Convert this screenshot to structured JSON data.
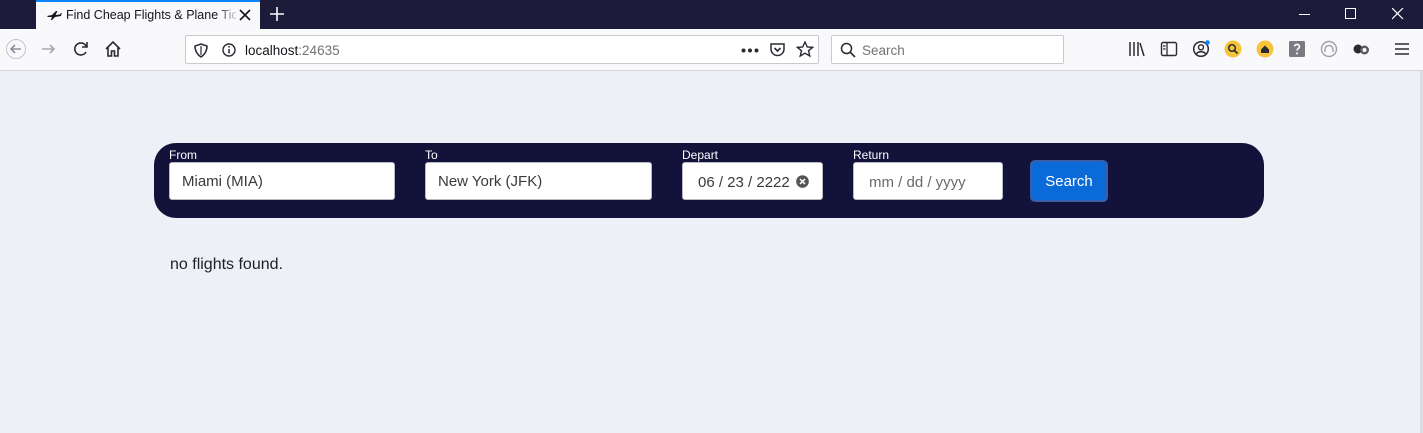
{
  "browser": {
    "tab_title": "Find Cheap Flights & Plane Tickets",
    "url_host": "localhost",
    "url_port": ":24635",
    "search_placeholder": "Search",
    "accent_color": "#0a84ff"
  },
  "form": {
    "from_label": "From",
    "from_value": "Miami (MIA)",
    "to_label": "To",
    "to_value": "New York (JFK)",
    "depart_label": "Depart",
    "depart_value": "06 / 23 / 2222",
    "return_label": "Return",
    "return_placeholder": "mm / dd / yyyy",
    "search_button": "Search",
    "card_color": "#12123a",
    "button_color": "#0a6ad8"
  },
  "results": {
    "message": "no flights found."
  }
}
